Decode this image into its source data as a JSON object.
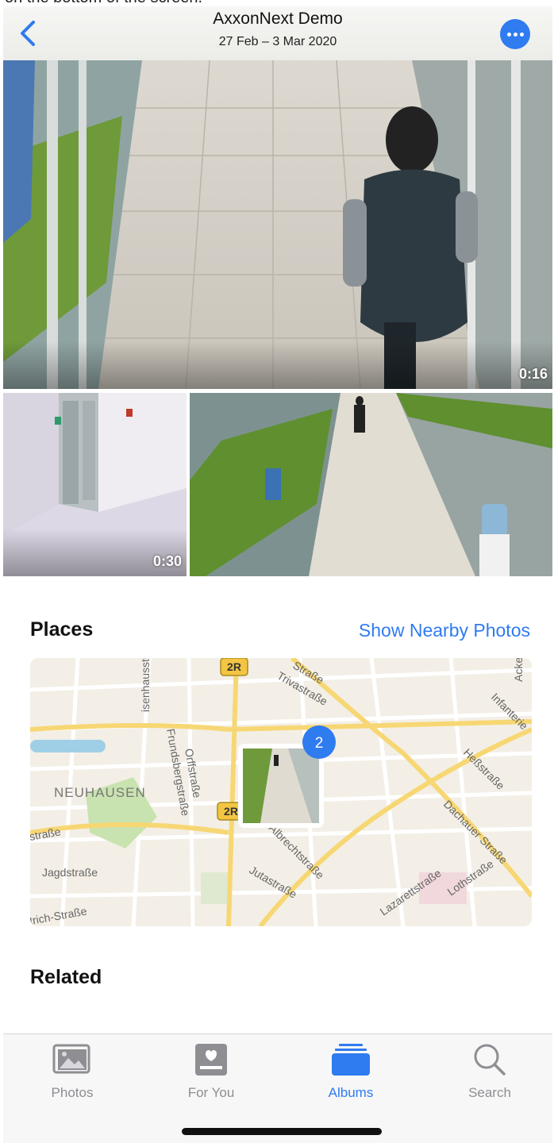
{
  "caption": "on the bottom of the screen.",
  "header": {
    "title": "AxxonNext Demo",
    "subtitle": "27 Feb – 3 Mar 2020"
  },
  "media": [
    {
      "duration": "0:16"
    },
    {
      "duration": "0:30"
    },
    {
      "duration": ""
    }
  ],
  "places": {
    "title": "Places",
    "link": "Show Nearby Photos",
    "map": {
      "cluster_count": "2",
      "district": "NEUHAUSEN",
      "road_badge": "2R",
      "streets": [
        "Trivastraße",
        "Straße",
        "Acke",
        "Infanterie",
        "Heßstraße",
        "Dachauer Straße",
        "Lothstraße",
        "Lazarettstraße",
        "Jutastraße",
        "Albrechtstraße",
        "Jagdstraße",
        "Orffstraße",
        "Frundsbergstraße",
        "isenhausstraße",
        "straße",
        "trich-Straße"
      ]
    }
  },
  "related": {
    "title": "Related"
  },
  "tabs": [
    {
      "label": "Photos",
      "icon": "photos-icon"
    },
    {
      "label": "For You",
      "icon": "for-you-icon"
    },
    {
      "label": "Albums",
      "icon": "albums-icon"
    },
    {
      "label": "Search",
      "icon": "search-icon"
    }
  ],
  "colors": {
    "accent": "#2f7bf0"
  }
}
